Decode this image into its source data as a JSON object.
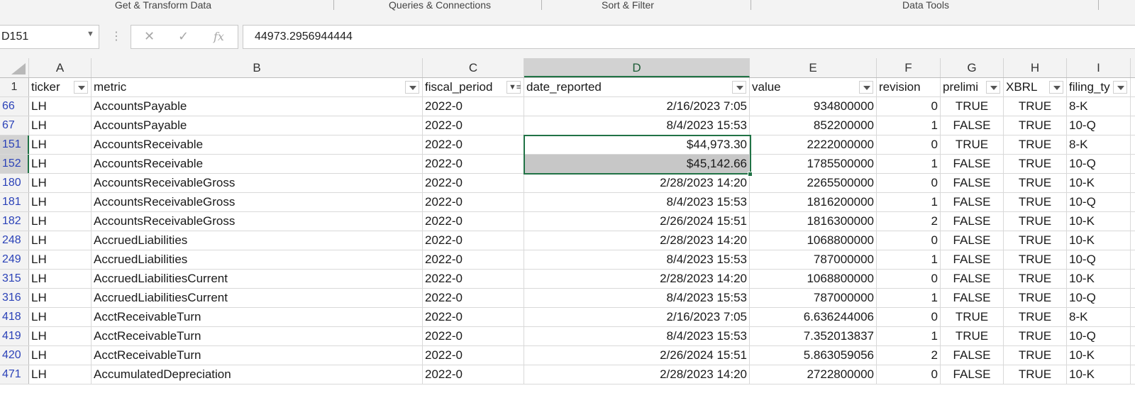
{
  "ribbon": {
    "groups": [
      "Get & Transform Data",
      "Queries & Connections",
      "Sort & Filter",
      "Data Tools"
    ]
  },
  "formula_bar": {
    "name_box": "D151",
    "fx_label": "fx",
    "value": "44973.2956944444"
  },
  "columns": {
    "letters": [
      "A",
      "B",
      "C",
      "D",
      "E",
      "F",
      "G",
      "H",
      "I"
    ],
    "selected": "D"
  },
  "header_row": {
    "row_number": "1",
    "labels": [
      "ticker",
      "metric",
      "fiscal_period",
      "date_reported",
      "value",
      "revision",
      "prelimi",
      "XBRL",
      "filing_ty"
    ]
  },
  "rows": [
    {
      "num": "66",
      "cells": [
        "LH",
        "AccountsPayable",
        "2022-0",
        "2/16/2023 7:05",
        "934800000",
        "0",
        "TRUE",
        "TRUE",
        "8-K"
      ]
    },
    {
      "num": "67",
      "cells": [
        "LH",
        "AccountsPayable",
        "2022-0",
        "8/4/2023 15:53",
        "852200000",
        "1",
        "FALSE",
        "TRUE",
        "10-Q"
      ]
    },
    {
      "num": "151",
      "cells": [
        "LH",
        "AccountsReceivable",
        "2022-0",
        "$44,973.30",
        "2222000000",
        "0",
        "TRUE",
        "TRUE",
        "8-K"
      ]
    },
    {
      "num": "152",
      "cells": [
        "LH",
        "AccountsReceivable",
        "2022-0",
        "$45,142.66",
        "1785500000",
        "1",
        "FALSE",
        "TRUE",
        "10-Q"
      ]
    },
    {
      "num": "180",
      "cells": [
        "LH",
        "AccountsReceivableGross",
        "2022-0",
        "2/28/2023 14:20",
        "2265500000",
        "0",
        "FALSE",
        "TRUE",
        "10-K"
      ]
    },
    {
      "num": "181",
      "cells": [
        "LH",
        "AccountsReceivableGross",
        "2022-0",
        "8/4/2023 15:53",
        "1816200000",
        "1",
        "FALSE",
        "TRUE",
        "10-Q"
      ]
    },
    {
      "num": "182",
      "cells": [
        "LH",
        "AccountsReceivableGross",
        "2022-0",
        "2/26/2024 15:51",
        "1816300000",
        "2",
        "FALSE",
        "TRUE",
        "10-K"
      ]
    },
    {
      "num": "248",
      "cells": [
        "LH",
        "AccruedLiabilities",
        "2022-0",
        "2/28/2023 14:20",
        "1068800000",
        "0",
        "FALSE",
        "TRUE",
        "10-K"
      ]
    },
    {
      "num": "249",
      "cells": [
        "LH",
        "AccruedLiabilities",
        "2022-0",
        "8/4/2023 15:53",
        "787000000",
        "1",
        "FALSE",
        "TRUE",
        "10-Q"
      ]
    },
    {
      "num": "315",
      "cells": [
        "LH",
        "AccruedLiabilitiesCurrent",
        "2022-0",
        "2/28/2023 14:20",
        "1068800000",
        "0",
        "FALSE",
        "TRUE",
        "10-K"
      ]
    },
    {
      "num": "316",
      "cells": [
        "LH",
        "AccruedLiabilitiesCurrent",
        "2022-0",
        "8/4/2023 15:53",
        "787000000",
        "1",
        "FALSE",
        "TRUE",
        "10-Q"
      ]
    },
    {
      "num": "418",
      "cells": [
        "LH",
        "AcctReceivableTurn",
        "2022-0",
        "2/16/2023 7:05",
        "6.636244006",
        "0",
        "TRUE",
        "TRUE",
        "8-K"
      ]
    },
    {
      "num": "419",
      "cells": [
        "LH",
        "AcctReceivableTurn",
        "2022-0",
        "8/4/2023 15:53",
        "7.352013837",
        "1",
        "TRUE",
        "TRUE",
        "10-Q"
      ]
    },
    {
      "num": "420",
      "cells": [
        "LH",
        "AcctReceivableTurn",
        "2022-0",
        "2/26/2024 15:51",
        "5.863059056",
        "2",
        "FALSE",
        "TRUE",
        "10-K"
      ]
    },
    {
      "num": "471",
      "cells": [
        "LH",
        "AccumulatedDepreciation",
        "2022-0",
        "2/28/2023 14:20",
        "2722800000",
        "0",
        "FALSE",
        "TRUE",
        "10-K"
      ]
    }
  ],
  "selection": {
    "active_cell": "D151",
    "range_rows": [
      "151",
      "152"
    ]
  },
  "colors": {
    "accent_green": "#217346",
    "row_number_blue": "#2b42b8",
    "header_bg": "#f3f3f3"
  }
}
